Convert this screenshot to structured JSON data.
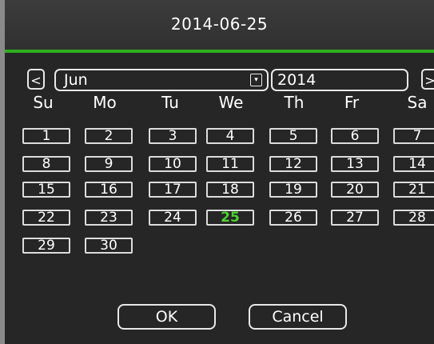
{
  "dialog": {
    "title": "2014-06-25"
  },
  "nav": {
    "prev_label": "<",
    "next_label": ">",
    "month": "Jun",
    "year": "2014",
    "dropdown_glyph": "▾"
  },
  "weekdays": [
    "Su",
    "Mo",
    "Tu",
    "We",
    "Th",
    "Fr",
    "Sa"
  ],
  "days": [
    "1",
    "2",
    "3",
    "4",
    "5",
    "6",
    "7",
    "8",
    "9",
    "10",
    "11",
    "12",
    "13",
    "14",
    "15",
    "16",
    "17",
    "18",
    "19",
    "20",
    "21",
    "22",
    "23",
    "24",
    "25",
    "26",
    "27",
    "28",
    "29",
    "30"
  ],
  "selected_day": "25",
  "buttons": {
    "ok": "OK",
    "cancel": "Cancel"
  },
  "colors": {
    "accent": "#2fae1f",
    "selected_day": "#4cd330",
    "background": "#262626",
    "text": "#ffffff"
  }
}
